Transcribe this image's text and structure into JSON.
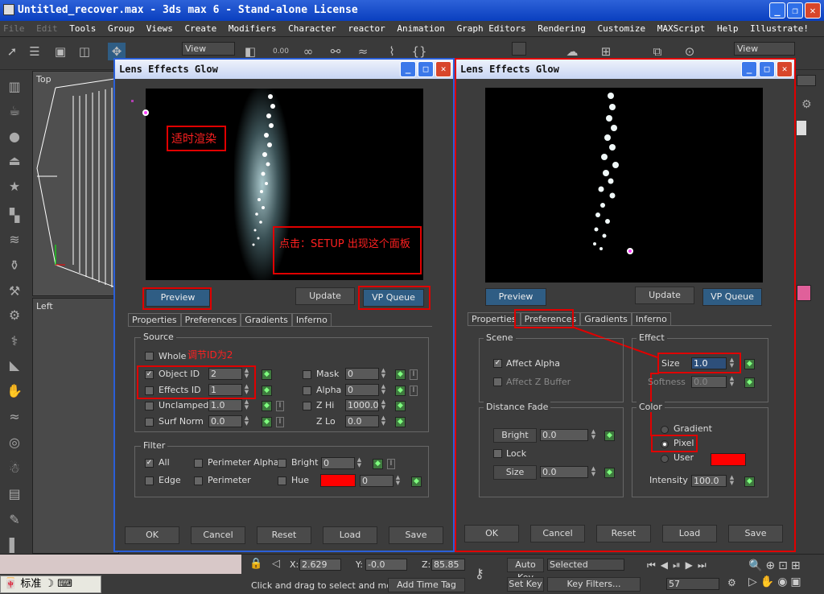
{
  "window": {
    "title": "Untitled_recover.max - 3ds max 6 - Stand-alone License",
    "min": "_",
    "max": "❐",
    "close": "✕"
  },
  "menu": [
    "File",
    "Edit",
    "Tools",
    "Group",
    "Views",
    "Create",
    "Modifiers",
    "Character",
    "reactor",
    "Animation",
    "Graph Editors",
    "Rendering",
    "Customize",
    "MAXScript",
    "Help",
    "Illustrate!"
  ],
  "menu_disabled": [
    "File",
    "Edit"
  ],
  "toolbar": {
    "view_left": "View",
    "view_right": "View",
    "num": "0.00"
  },
  "viewports": {
    "top": "Top",
    "left": "Left"
  },
  "dialog_left": {
    "title": "Lens Effects Glow",
    "note1": "适时渲染",
    "note2": "点击：SETUP  出现这个面板",
    "note3": "调节ID为2",
    "buttons": {
      "preview": "Preview",
      "update": "Update",
      "vpqueue": "VP Queue"
    },
    "tabs": [
      "Properties",
      "Preferences",
      "Gradients",
      "Inferno"
    ],
    "source": {
      "label": "Source",
      "whole": "Whole",
      "object_id": "Object ID",
      "object_id_val": "2",
      "effects_id": "Effects ID",
      "effects_id_val": "1",
      "unclamped": "Unclamped",
      "unclamped_val": "1.0",
      "surf_norm": "Surf Norm",
      "surf_norm_val": "0.0",
      "mask": "Mask",
      "mask_val": "0",
      "alpha": "Alpha",
      "alpha_val": "0",
      "zhi": "Z Hi",
      "zhi_val": "1000.0",
      "zlo": "Z Lo",
      "zlo_val": "0.0"
    },
    "filter": {
      "label": "Filter",
      "all": "All",
      "perimeter_alpha": "Perimeter Alpha",
      "bright": "Bright",
      "bright_val": "0",
      "edge": "Edge",
      "perimeter": "Perimeter",
      "hue": "Hue",
      "hue_val": "0",
      "hue_color": "#ff0000"
    },
    "footer": {
      "ok": "OK",
      "cancel": "Cancel",
      "reset": "Reset",
      "load": "Load",
      "save": "Save"
    }
  },
  "dialog_right": {
    "title": "Lens Effects Glow",
    "buttons": {
      "preview": "Preview",
      "update": "Update",
      "vpqueue": "VP Queue"
    },
    "tabs": [
      "Properties",
      "Preferences",
      "Gradients",
      "Inferno"
    ],
    "scene": {
      "label": "Scene",
      "affect_alpha": "Affect Alpha",
      "affect_zbuffer": "Affect Z Buffer"
    },
    "effect": {
      "label": "Effect",
      "size": "Size",
      "size_val": "1.0",
      "softness": "Softness",
      "softness_val": "0.0"
    },
    "distance_fade": {
      "label": "Distance Fade",
      "bright": "Bright",
      "bright_val": "0.0",
      "lock": "Lock",
      "size": "Size",
      "size_val": "0.0"
    },
    "color": {
      "label": "Color",
      "gradient": "Gradient",
      "pixel": "Pixel",
      "user": "User",
      "user_color": "#ff0000",
      "intensity": "Intensity",
      "intensity_val": "100.0"
    },
    "footer": {
      "ok": "OK",
      "cancel": "Cancel",
      "reset": "Reset",
      "load": "Load",
      "save": "Save"
    }
  },
  "status": {
    "x_label": "X:",
    "x_val": "2.629",
    "y_label": "Y:",
    "y_val": "-0.0",
    "z_label": "Z:",
    "z_val": "85.85",
    "prompt": "Click and drag to select and move",
    "add_time_tag": "Add Time Tag",
    "auto_key": "Auto Key",
    "selected": "Selected",
    "set_key": "Set Key",
    "key_filters": "Key Filters...",
    "frame": "57",
    "ime": "标准"
  }
}
